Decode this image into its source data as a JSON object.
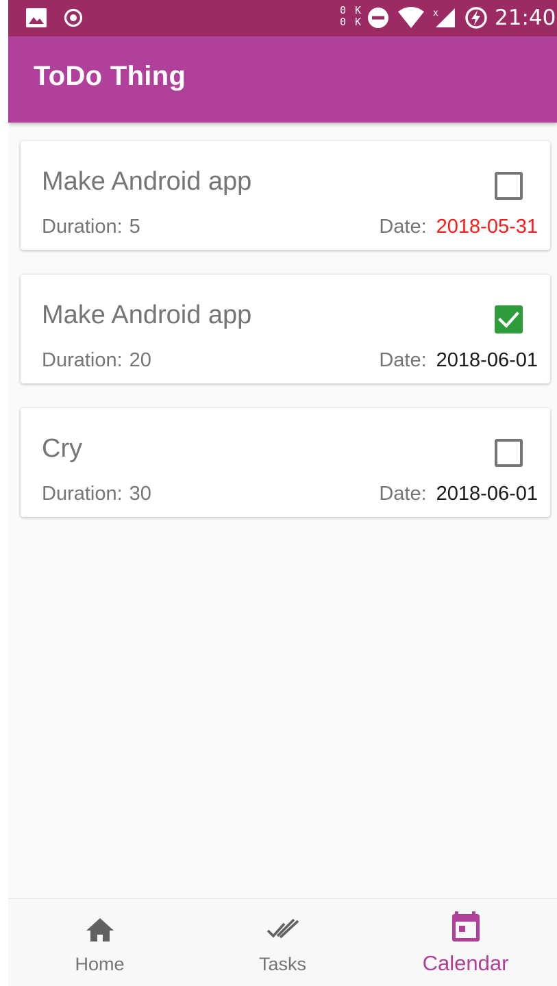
{
  "status_bar": {
    "net_up": "0 K",
    "net_down": "0 K",
    "time": "21:40",
    "icons": [
      "gallery-icon",
      "record-icon",
      "do-not-disturb-icon",
      "wifi-icon",
      "signal-icon",
      "battery-charging-icon"
    ]
  },
  "app_bar": {
    "title": "ToDo Thing",
    "color": "#b1409a"
  },
  "tasks": [
    {
      "name": "Make Android app",
      "duration_label": "Duration:",
      "duration": "5",
      "date_label": "Date:",
      "date": "2018-05-31",
      "checked": false,
      "overdue": true
    },
    {
      "name": "Make Android app",
      "duration_label": "Duration:",
      "duration": "20",
      "date_label": "Date:",
      "date": "2018-06-01",
      "checked": true,
      "overdue": false
    },
    {
      "name": "Cry",
      "duration_label": "Duration:",
      "duration": "30",
      "date_label": "Date:",
      "date": "2018-06-01",
      "checked": false,
      "overdue": false
    }
  ],
  "bottom_nav": {
    "items": [
      {
        "label": "Home",
        "icon": "home-icon",
        "active": false
      },
      {
        "label": "Tasks",
        "icon": "double-check-icon",
        "active": false
      },
      {
        "label": "Calendar",
        "icon": "calendar-icon",
        "active": true
      }
    ]
  },
  "colors": {
    "status_bar": "#9c2b63",
    "accent": "#b1409a",
    "checked": "#2e9c3a",
    "overdue_date": "#ff1a1a"
  }
}
